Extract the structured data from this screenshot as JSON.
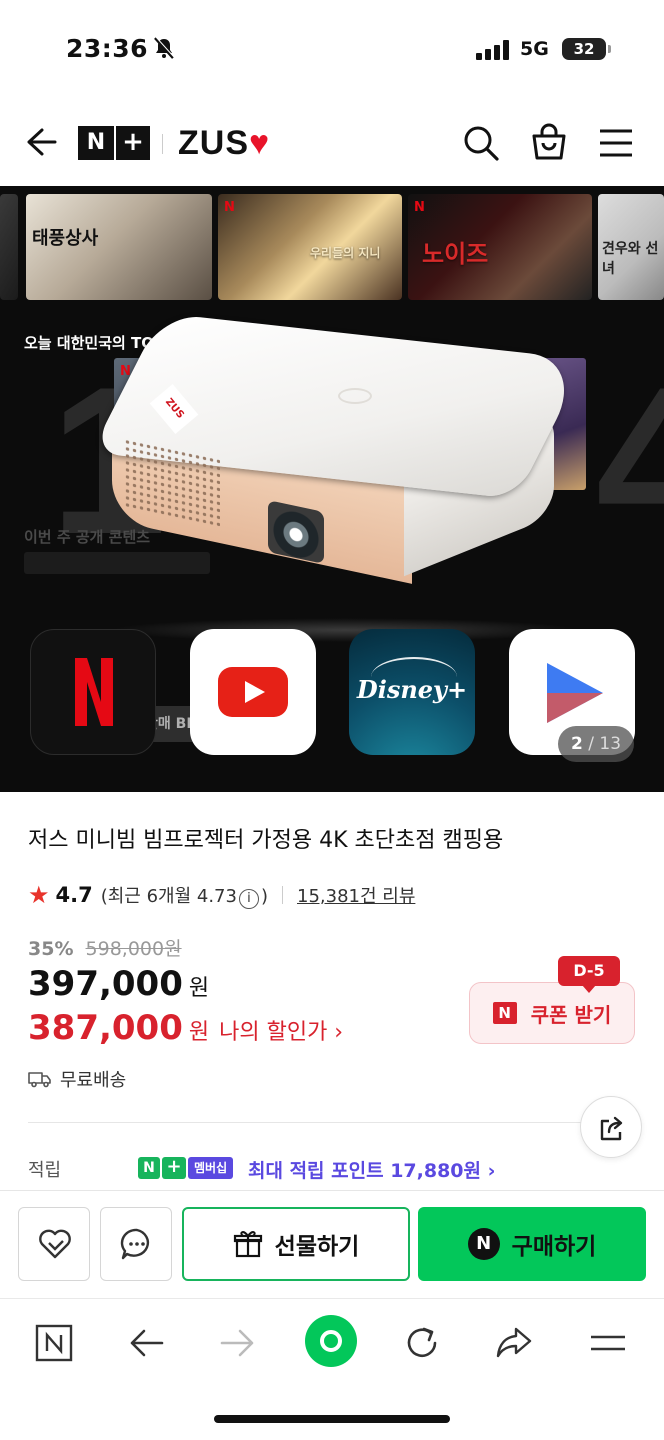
{
  "status_bar": {
    "time": "23:36",
    "network": "5G",
    "battery": "32",
    "battery_level_pct": 32
  },
  "header": {
    "brand_badge_n": "N",
    "brand_badge_plus": "+",
    "brand_name": "ZUS"
  },
  "hero": {
    "thumbnails": [
      {
        "title": ""
      },
      {
        "title": "태풍상사"
      },
      {
        "title": "우리들의 지니"
      },
      {
        "title": "노이즈"
      },
      {
        "title": "견우와 선녀"
      }
    ],
    "top10_label": "오늘 대한민국의 TOP 10 영화",
    "weekly_label": "이번 주 공개 콘텐츠",
    "best_strip": "최근 3일간 판매 BEST 상품",
    "apps": [
      "Netflix",
      "YouTube",
      "Disney+",
      "Play"
    ],
    "pager_current": "2",
    "pager_separator": "/",
    "pager_total": "13"
  },
  "product": {
    "title": "저스 미니빔 빔프로젝터 가정용 4K 초단초점 캠핑용",
    "rating": "4.7",
    "recent_rating_prefix": "(최근 6개월 4.73",
    "recent_rating_suffix": ")",
    "review_count": "15,381건 리뷰",
    "discount_pct": "35%",
    "original_price": "598,000원",
    "price": "397,000",
    "price_unit": "원",
    "my_price": "387,000",
    "my_price_unit": "원",
    "my_price_label": "나의 할인가 ›",
    "coupon_label": "쿠폰 받기",
    "coupon_dday": "D-5",
    "shipping": "무료배송",
    "points_label": "적립",
    "membership_badge": "멤버십",
    "points_text": "최대 적립 포인트 17,880원 ›"
  },
  "actions": {
    "gift_label": "선물하기",
    "buy_label": "구매하기"
  }
}
